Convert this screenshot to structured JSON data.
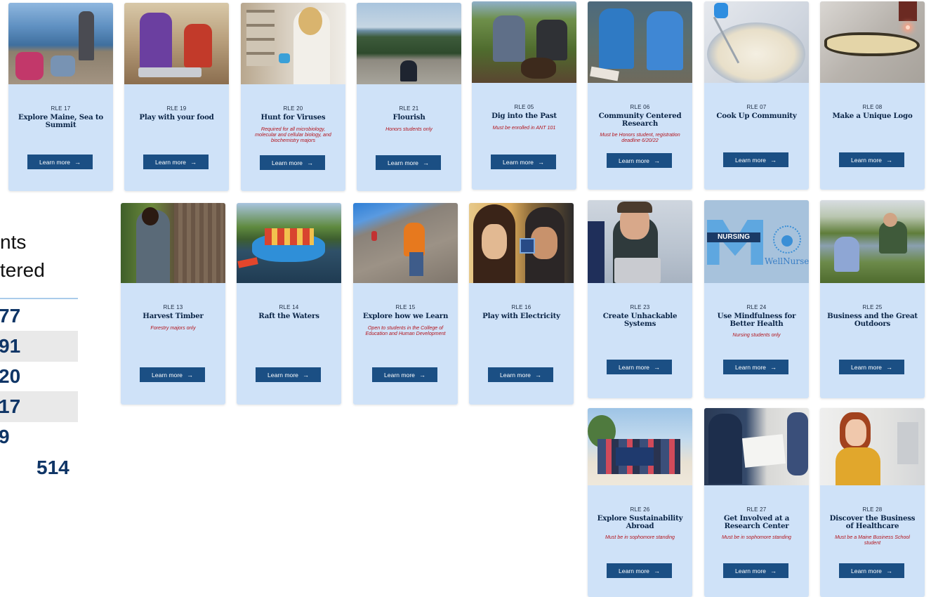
{
  "stats": {
    "label_line1": "nts",
    "label_line2": "tered",
    "values": [
      "77",
      "91",
      "20",
      "17",
      "9"
    ],
    "total": "514"
  },
  "button_label": "Learn more",
  "colors": {
    "card_bg": "#cfe2f8",
    "button": "#1b4f84",
    "title": "#0b2547",
    "note": "#b3131b"
  },
  "cards": [
    {
      "code": "RLE 17",
      "title": "Explore Maine, Sea to Summit",
      "note": "",
      "photo": "coastal-hikers"
    },
    {
      "code": "RLE 19",
      "title": "Play with your food",
      "note": "",
      "photo": "food-lab"
    },
    {
      "code": "RLE 20",
      "title": "Hunt for Viruses",
      "note": "Required for all microbiology, molecular and cellular biology, and biochemistry majors",
      "photo": "virus-lab"
    },
    {
      "code": "RLE 21",
      "title": "Flourish",
      "note": "Honors students only",
      "photo": "mountain-view"
    },
    {
      "code": "RLE 05",
      "title": "Dig into the Past",
      "note": "Must be enrolled in ANT 101",
      "photo": "excavation"
    },
    {
      "code": "RLE 06",
      "title": "Community Centered Research",
      "note": "Must be Honors student, registration deadline 6/20/22",
      "photo": "shore-research"
    },
    {
      "code": "RLE 07",
      "title": "Cook Up Community",
      "note": "",
      "photo": "mixing-bowl"
    },
    {
      "code": "RLE 08",
      "title": "Make a Unique Logo",
      "note": "",
      "photo": "laser-engraving"
    },
    {
      "code": "RLE 13",
      "title": "Harvest Timber",
      "note": "Forestry majors only",
      "photo": "forest-tree"
    },
    {
      "code": "RLE 14",
      "title": "Raft the Waters",
      "note": "",
      "photo": "river-raft"
    },
    {
      "code": "RLE 15",
      "title": "Explore how we Learn",
      "note": "Open to students in the College of Education and Human Development",
      "photo": "rock-climbing"
    },
    {
      "code": "RLE 16",
      "title": "Play with Electricity",
      "note": "",
      "photo": "circuit-board"
    },
    {
      "code": "RLE 23",
      "title": "Create Unhackable Systems",
      "note": "",
      "photo": "laptop-student"
    },
    {
      "code": "RLE 24",
      "title": "Use Mindfulness for Better Health",
      "note": "Nursing students only",
      "photo": "nursing-logo"
    },
    {
      "code": "RLE 25",
      "title": "Business and the Great Outdoors",
      "note": "",
      "photo": "lakeside"
    },
    {
      "code": "RLE 26",
      "title": "Explore Sustainability Abroad",
      "note": "Must be in sophomore standing",
      "photo": "beach-group"
    },
    {
      "code": "RLE 27",
      "title": "Get Involved at a Research Center",
      "note": "Must be in sophomore standing",
      "photo": "clipboard"
    },
    {
      "code": "RLE 28",
      "title": "Discover the Business of Healthcare",
      "note": "Must be a Maine Business School student",
      "photo": "portrait"
    }
  ],
  "logo_text": {
    "banner": "NURSING",
    "brand": "WellNurse"
  }
}
